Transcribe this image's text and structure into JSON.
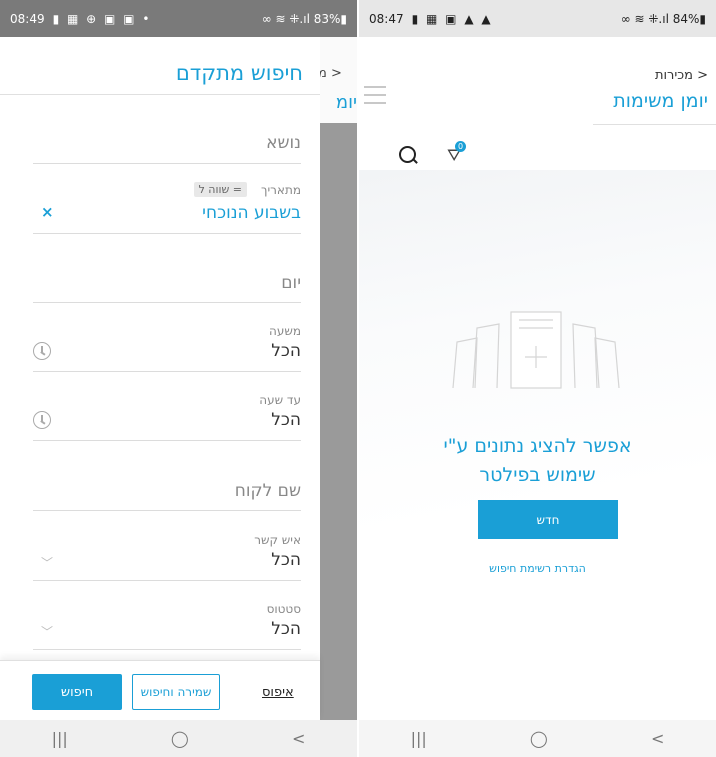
{
  "left": {
    "status": {
      "time": "08:49",
      "icons": "▮ ▦ ⊕ ▣ ▣ •",
      "right": "∞ ≋ ⁜.ıl 83%▮"
    },
    "underlay": {
      "crumb": "< מ",
      "title": "יומ"
    },
    "drawer": {
      "title": "חיפוש מתקדם",
      "subject_placeholder": "נושא",
      "date": {
        "label": "מתאריך",
        "operator": "= שווה ל",
        "value": "בשבוע הנוכחי",
        "clear_icon": "×"
      },
      "day_placeholder": "יום",
      "from_time": {
        "label": "משעה",
        "value": "הכל"
      },
      "to_time": {
        "label": "עד שעה",
        "value": "הכל"
      },
      "customer_placeholder": "שם לקוח",
      "contact": {
        "label": "איש קשר",
        "value": "הכל"
      },
      "status": {
        "label": "סטטוס",
        "value": "הכל"
      },
      "buttons": {
        "search": "חיפוש",
        "save_and_search": "שמירה וחיפוש",
        "reset": "איפוס"
      }
    },
    "nav": {
      "recent": "|||",
      "home": "◯",
      "back": "<"
    }
  },
  "right": {
    "status": {
      "time": "08:47",
      "icons": "▮ ▦ ▣ ▲ ▲",
      "right": "∞ ≋ ⁜.ıl 84%▮"
    },
    "crumb": "< מכירות",
    "title": "יומן משימות",
    "filter_count": "0",
    "empty_message_line1": "אפשר להציג נתונים ע\"י",
    "empty_message_line2": "שימוש בפילטר",
    "new_button": "חדש",
    "define_search_link": "הגדרת רשימת חיפוש",
    "nav": {
      "recent": "|||",
      "home": "◯",
      "back": "<"
    }
  }
}
